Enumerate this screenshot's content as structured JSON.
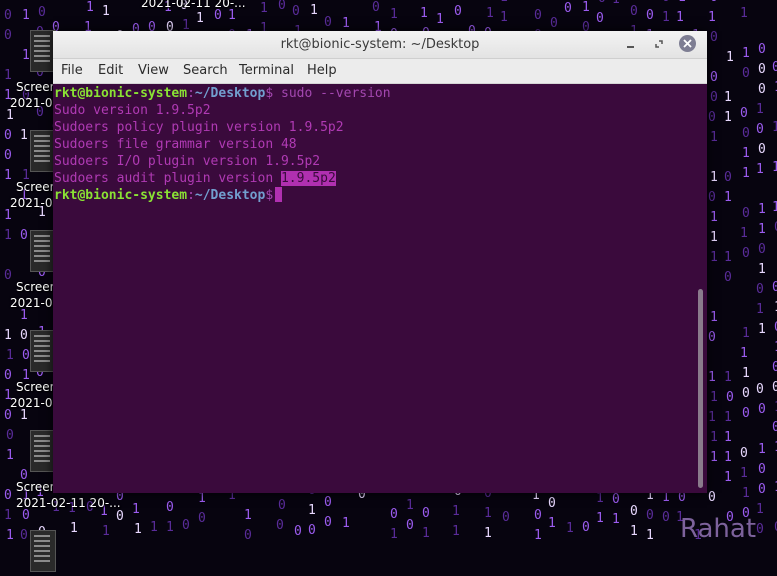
{
  "desktop": {
    "icons": [
      {
        "label": "2021-02-11 20-...",
        "label_line1": "Screer",
        "label_line2": "2021-0"
      },
      {
        "label_line1": "Screer",
        "label_line2": "2021-0"
      },
      {
        "label_line1": "Screer",
        "label_line2": "2021-0"
      },
      {
        "label_line1": "Screer",
        "label_line2": "2021-0"
      },
      {
        "label_line1": "Screer",
        "label_line2": "2021-02-11 20-..."
      }
    ],
    "top_label": "2021-02-11 20-...",
    "watermark": "Rahat"
  },
  "window": {
    "title": "rkt@bionic-system: ~/Desktop",
    "menu": [
      "File",
      "Edit",
      "View",
      "Search",
      "Terminal",
      "Help"
    ]
  },
  "terminal": {
    "prompt_user": "rkt@bionic-system",
    "prompt_sep": ":",
    "prompt_path": "~/Desktop",
    "prompt_end": "$",
    "command": " sudo --version",
    "output": [
      "Sudo version 1.9.5p2",
      "Sudoers policy plugin version 1.9.5p2",
      "Sudoers file grammar version 48",
      "Sudoers I/O plugin version 1.9.5p2"
    ],
    "last_output_prefix": "Sudoers audit plugin version ",
    "last_output_selected": "1.9.5p2"
  },
  "colors": {
    "terminal_bg": "#3a0a3c",
    "user": "#8ae234",
    "path": "#729fcf",
    "text": "#b03ab4"
  }
}
